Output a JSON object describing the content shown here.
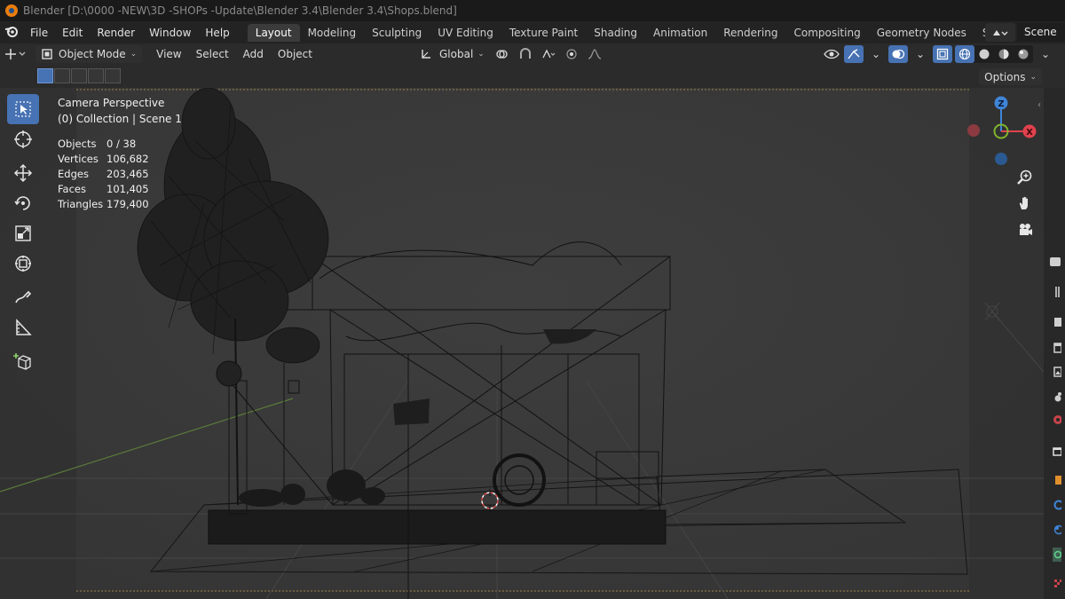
{
  "window": {
    "title": "Blender [D:\\0000 -NEW\\3D -SHOPs -Update\\Blender 3.4\\Blender 3.4\\Shops.blend]"
  },
  "menu": {
    "items": [
      "File",
      "Edit",
      "Render",
      "Window",
      "Help"
    ]
  },
  "workspaces": {
    "tabs": [
      "Layout",
      "Modeling",
      "Sculpting",
      "UV Editing",
      "Texture Paint",
      "Shading",
      "Animation",
      "Rendering",
      "Compositing",
      "Geometry Nodes",
      "Scripting"
    ],
    "active": "Layout",
    "add_label": "+"
  },
  "scene": {
    "name": "Scene"
  },
  "viewport_header": {
    "mode": "Object Mode",
    "menus": [
      "View",
      "Select",
      "Add",
      "Object"
    ],
    "transform_orientation": "Global"
  },
  "options_label": "Options",
  "overlay": {
    "view_name": "Camera Perspective",
    "collection": "(0) Collection | Scene 1"
  },
  "stats": {
    "rows": [
      {
        "label": "Objects",
        "value": "0 / 38"
      },
      {
        "label": "Vertices",
        "value": "106,682"
      },
      {
        "label": "Edges",
        "value": "203,465"
      },
      {
        "label": "Faces",
        "value": "101,405"
      },
      {
        "label": "Triangles",
        "value": "179,400"
      }
    ]
  },
  "gizmo": {
    "z_label": "Z",
    "x_label": "X"
  },
  "colors": {
    "accent": "#4772b3",
    "axis_x": "#e0424e",
    "axis_y": "#80b42c",
    "axis_z": "#3f85d8"
  }
}
